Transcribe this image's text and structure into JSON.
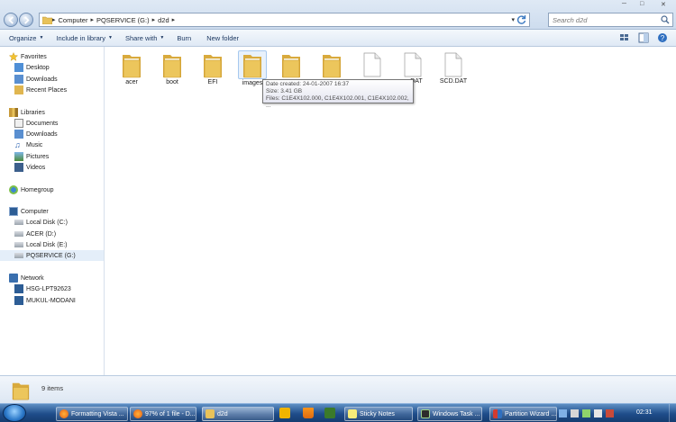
{
  "address_bar": {
    "crumbs": [
      "Computer",
      "PQSERVICE (G:)",
      "d2d"
    ],
    "search_placeholder": "Search d2d"
  },
  "toolbar": {
    "organize": "Organize",
    "include_in_library": "Include in library",
    "share_with": "Share with",
    "burn": "Burn",
    "new_folder": "New folder"
  },
  "nav": {
    "favorites": {
      "header": "Favorites",
      "items": [
        "Desktop",
        "Downloads",
        "Recent Places"
      ]
    },
    "libraries": {
      "header": "Libraries",
      "items": [
        "Documents",
        "Downloads",
        "Music",
        "Pictures",
        "Videos"
      ]
    },
    "homegroup": "Homegroup",
    "computer": {
      "header": "Computer",
      "items": [
        "Local Disk (C:)",
        "ACER (D:)",
        "Local Disk (E:)",
        "PQSERVICE (G:)"
      ]
    },
    "network": {
      "header": "Network",
      "items": [
        "HSG-LPT92623",
        "MUKUL-MODANI"
      ]
    }
  },
  "files": [
    {
      "name": "acer",
      "type": "folder"
    },
    {
      "name": "boot",
      "type": "folder"
    },
    {
      "name": "EFI",
      "type": "folder"
    },
    {
      "name": "images",
      "type": "folder"
    },
    {
      "name": "",
      "type": "folder"
    },
    {
      "name": "",
      "type": "folder"
    },
    {
      "name": "",
      "type": "file"
    },
    {
      "name": ".DAT",
      "type": "file"
    },
    {
      "name": "SCD.DAT",
      "type": "file"
    }
  ],
  "tooltip": {
    "date_created": "Date created: 24-01-2007 16:37",
    "size": "Size: 3.41 GB",
    "files": "Files: C1E4X102.000, C1E4X102.001, C1E4X102.002, ..."
  },
  "details": {
    "count": "9 items"
  },
  "taskbar": {
    "buttons": [
      "Formatting Vista ...",
      "97% of 1 file - D...",
      "d2d",
      "Sticky Notes",
      "Windows Task ...",
      "Partition Wizard ..."
    ],
    "clock": "02:31"
  },
  "colors": {
    "folder": "#e8c25a",
    "accent": "#1e3962",
    "taskbar": "#1f4d8a"
  }
}
